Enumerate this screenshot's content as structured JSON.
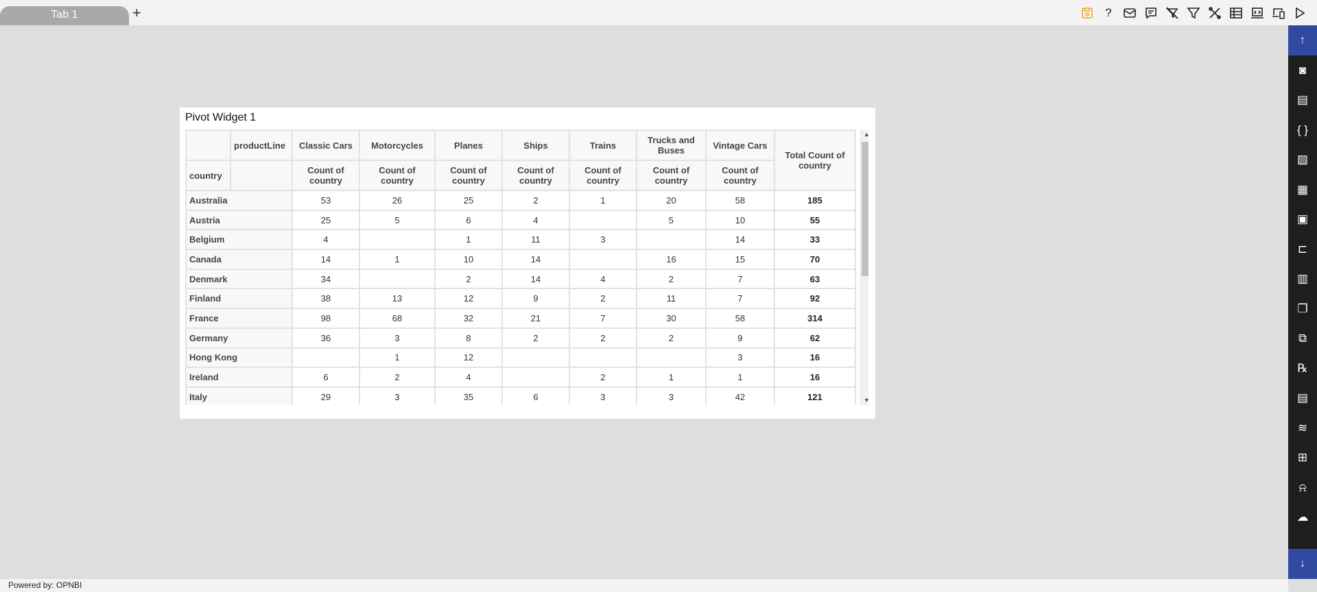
{
  "tabs": [
    {
      "label": "Tab 1"
    }
  ],
  "add_tab": "+",
  "toolbar": [
    "save-icon",
    "help-icon",
    "email-icon",
    "comment-icon",
    "clear-filter-icon",
    "filter-icon",
    "tools-icon",
    "table-icon",
    "embed-icon",
    "devices-icon",
    "play-icon"
  ],
  "toolbar_accent": "#f5a623",
  "sidebar": {
    "top": "↑",
    "bottom": "↓",
    "items": [
      "report-icon",
      "document-icon",
      "braces-icon",
      "image-icon",
      "layout-icon",
      "form-icon",
      "hierarchy-icon",
      "chart-icon",
      "copy-icon",
      "cubes-icon",
      "rx-icon",
      "file-icon",
      "layers-icon",
      "add-widget-icon",
      "alert-icon",
      "cloud-upload-icon"
    ],
    "accent": "#2f4aa0"
  },
  "widget": {
    "title": "Pivot Widget 1",
    "row_field": "country",
    "col_field": "productLine",
    "columns": [
      "Classic Cars",
      "Motorcycles",
      "Planes",
      "Ships",
      "Trains",
      "Trucks and Buses",
      "Vintage Cars"
    ],
    "measure": "Count of country",
    "total_label": "Total Count of country",
    "rows": [
      {
        "country": "Australia",
        "values": [
          "53",
          "26",
          "25",
          "2",
          "1",
          "20",
          "58"
        ],
        "total": "185"
      },
      {
        "country": "Austria",
        "values": [
          "25",
          "5",
          "6",
          "4",
          "",
          "5",
          "10"
        ],
        "total": "55"
      },
      {
        "country": "Belgium",
        "values": [
          "4",
          "",
          "1",
          "11",
          "3",
          "",
          "14"
        ],
        "total": "33"
      },
      {
        "country": "Canada",
        "values": [
          "14",
          "1",
          "10",
          "14",
          "",
          "16",
          "15"
        ],
        "total": "70"
      },
      {
        "country": "Denmark",
        "values": [
          "34",
          "",
          "2",
          "14",
          "4",
          "2",
          "7"
        ],
        "total": "63"
      },
      {
        "country": "Finland",
        "values": [
          "38",
          "13",
          "12",
          "9",
          "2",
          "11",
          "7"
        ],
        "total": "92"
      },
      {
        "country": "France",
        "values": [
          "98",
          "68",
          "32",
          "21",
          "7",
          "30",
          "58"
        ],
        "total": "314"
      },
      {
        "country": "Germany",
        "values": [
          "36",
          "3",
          "8",
          "2",
          "2",
          "2",
          "9"
        ],
        "total": "62"
      },
      {
        "country": "Hong Kong",
        "values": [
          "",
          "1",
          "12",
          "",
          "",
          "",
          "3"
        ],
        "total": "16"
      },
      {
        "country": "Ireland",
        "values": [
          "6",
          "2",
          "4",
          "",
          "2",
          "1",
          "1"
        ],
        "total": "16"
      },
      {
        "country": "Italy",
        "values": [
          "29",
          "3",
          "35",
          "6",
          "3",
          "3",
          "42"
        ],
        "total": "121"
      }
    ]
  },
  "footer": "Powered by: OPNBI"
}
